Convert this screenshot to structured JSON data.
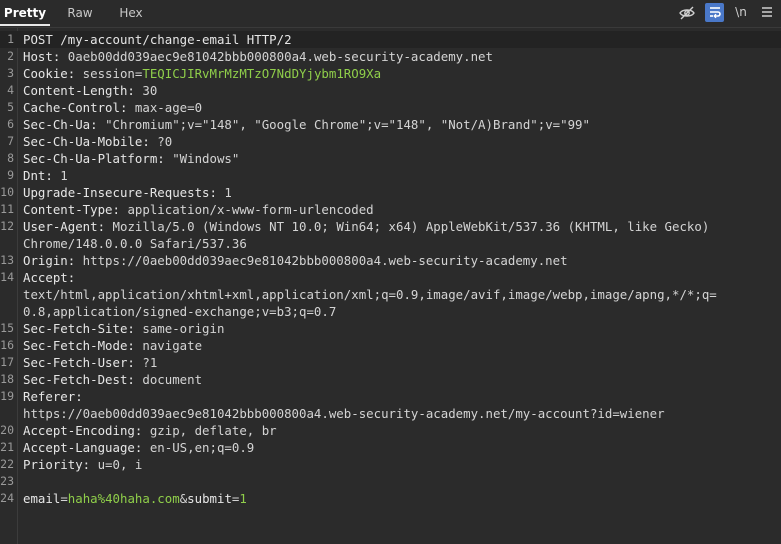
{
  "tabs": [
    "Pretty",
    "Raw",
    "Hex"
  ],
  "toolbar": {
    "newline_label": "\\n"
  },
  "lines": [
    {
      "num": "1",
      "text": "POST /my-account/change-email HTTP/2"
    },
    {
      "num": "2",
      "name": "Host:",
      "value": " 0aeb00dd039aec9e81042bbb000800a4.web-security-academy.net"
    },
    {
      "num": "3",
      "name": "Cookie:",
      "cookie_name": " session",
      "cookie_eq": "=",
      "cookie_val": "TEQICJIRvMrMzMTzO7NdDYjybm1RO9Xa"
    },
    {
      "num": "4",
      "name": "Content-Length:",
      "value": " 30"
    },
    {
      "num": "5",
      "name": "Cache-Control:",
      "value": " max-age=0"
    },
    {
      "num": "6",
      "name": "Sec-Ch-Ua:",
      "value": " \"Chromium\";v=\"148\", \"Google Chrome\";v=\"148\", \"Not/A)Brand\";v=\"99\""
    },
    {
      "num": "7",
      "name": "Sec-Ch-Ua-Mobile:",
      "value": " ?0"
    },
    {
      "num": "8",
      "name": "Sec-Ch-Ua-Platform:",
      "value": " \"Windows\""
    },
    {
      "num": "9",
      "name": "Dnt:",
      "value": " 1"
    },
    {
      "num": "10",
      "name": "Upgrade-Insecure-Requests:",
      "value": " 1"
    },
    {
      "num": "11",
      "name": "Content-Type:",
      "value": " application/x-www-form-urlencoded"
    },
    {
      "num": "12",
      "name": "User-Agent:",
      "value": " Mozilla/5.0 (Windows NT 10.0; Win64; x64) AppleWebKit/537.36 (KHTML, like Gecko)"
    },
    {
      "num": "",
      "value": "Chrome/148.0.0.0 Safari/537.36"
    },
    {
      "num": "13",
      "name": "Origin:",
      "value": " https://0aeb00dd039aec9e81042bbb000800a4.web-security-academy.net"
    },
    {
      "num": "14",
      "name": "Accept:",
      "value": ""
    },
    {
      "num": "",
      "value": "text/html,application/xhtml+xml,application/xml;q=0.9,image/avif,image/webp,image/apng,*/*;q="
    },
    {
      "num": "",
      "value": "0.8,application/signed-exchange;v=b3;q=0.7"
    },
    {
      "num": "15",
      "name": "Sec-Fetch-Site:",
      "value": " same-origin"
    },
    {
      "num": "16",
      "name": "Sec-Fetch-Mode:",
      "value": " navigate"
    },
    {
      "num": "17",
      "name": "Sec-Fetch-User:",
      "value": " ?1"
    },
    {
      "num": "18",
      "name": "Sec-Fetch-Dest:",
      "value": " document"
    },
    {
      "num": "19",
      "name": "Referer:",
      "value": ""
    },
    {
      "num": "",
      "value": "https://0aeb00dd039aec9e81042bbb000800a4.web-security-academy.net/my-account?id=wiener"
    },
    {
      "num": "20",
      "name": "Accept-Encoding:",
      "value": " gzip, deflate, br"
    },
    {
      "num": "21",
      "name": "Accept-Language:",
      "value": " en-US,en;q=0.9"
    },
    {
      "num": "22",
      "name": "Priority:",
      "value": " u=0, i"
    },
    {
      "num": "23",
      "value": ""
    },
    {
      "num": "24",
      "body": [
        {
          "t": "email",
          "c": "hname"
        },
        {
          "t": "=",
          "c": "hval"
        },
        {
          "t": "haha%40haha.com",
          "c": "green"
        },
        {
          "t": "&",
          "c": "hval"
        },
        {
          "t": "submit",
          "c": "hname"
        },
        {
          "t": "=",
          "c": "hval"
        },
        {
          "t": "1",
          "c": "green"
        }
      ]
    }
  ]
}
